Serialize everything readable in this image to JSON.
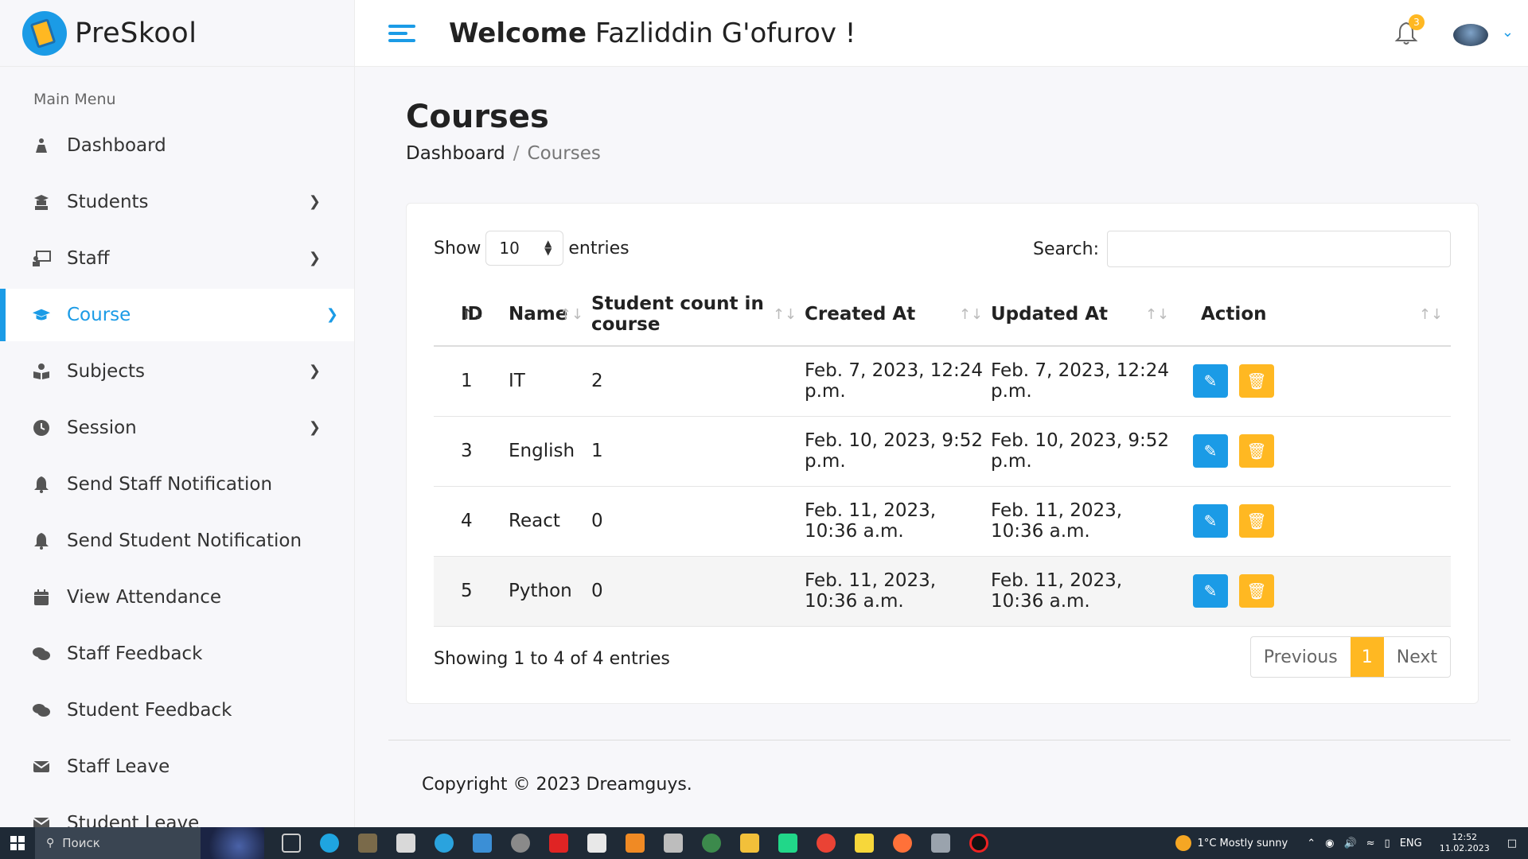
{
  "brand": {
    "name": "PreSkool"
  },
  "sidebar": {
    "menu_title": "Main Menu",
    "items": [
      {
        "label": "Dashboard",
        "icon": "dashboard-icon"
      },
      {
        "label": "Students",
        "icon": "graduate-icon"
      },
      {
        "label": "Staff",
        "icon": "teacher-icon"
      },
      {
        "label": "Course",
        "icon": "mortarboard-icon",
        "active": true
      },
      {
        "label": "Subjects",
        "icon": "book-reader-icon"
      },
      {
        "label": "Session",
        "icon": "clock-icon"
      },
      {
        "label": "Send Staff Notification",
        "icon": "bell-icon"
      },
      {
        "label": "Send Student Notification",
        "icon": "bell-icon"
      },
      {
        "label": "View Attendance",
        "icon": "calendar-icon"
      },
      {
        "label": "Staff Feedback",
        "icon": "comments-icon"
      },
      {
        "label": "Student Feedback",
        "icon": "comments-icon"
      },
      {
        "label": "Staff Leave",
        "icon": "envelope-icon"
      },
      {
        "label": "Student Leave",
        "icon": "envelope-icon"
      }
    ]
  },
  "header": {
    "welcome_bold": "Welcome",
    "user_name": "Fazliddin G'ofurov !",
    "notification_count": "3"
  },
  "page": {
    "title": "Courses",
    "breadcrumb": {
      "parent": "Dashboard",
      "separator": "/",
      "current": "Courses"
    }
  },
  "table_controls": {
    "show_label": "Show",
    "entries_value": "10",
    "entries_label": "entries",
    "search_label": "Search:",
    "search_value": ""
  },
  "table": {
    "columns": [
      "ID",
      "Name",
      "Student count in course",
      "Created At",
      "Updated At",
      "Action"
    ],
    "rows": [
      {
        "id": "1",
        "name": "IT",
        "count": "2",
        "created": "Feb. 7, 2023, 12:24 p.m.",
        "updated": "Feb. 7, 2023, 12:24 p.m."
      },
      {
        "id": "3",
        "name": "English",
        "count": "1",
        "created": "Feb. 10, 2023, 9:52 p.m.",
        "updated": "Feb. 10, 2023, 9:52 p.m."
      },
      {
        "id": "4",
        "name": "React",
        "count": "0",
        "created": "Feb. 11, 2023, 10:36 a.m.",
        "updated": "Feb. 11, 2023, 10:36 a.m."
      },
      {
        "id": "5",
        "name": "Python",
        "count": "0",
        "created": "Feb. 11, 2023, 10:36 a.m.",
        "updated": "Feb. 11, 2023, 10:36 a.m."
      }
    ]
  },
  "pagination": {
    "info": "Showing 1 to 4 of 4 entries",
    "previous": "Previous",
    "current_page": "1",
    "next": "Next"
  },
  "footer": {
    "copyright": "Copyright © 2023 Dreamguys."
  },
  "taskbar": {
    "search_placeholder": "Поиск",
    "weather": "1°C  Mostly sunny",
    "language": "ENG",
    "time": "12:52",
    "date": "11.02.2023"
  },
  "colors": {
    "accent": "#1b9be6",
    "warning": "#ffb822"
  }
}
